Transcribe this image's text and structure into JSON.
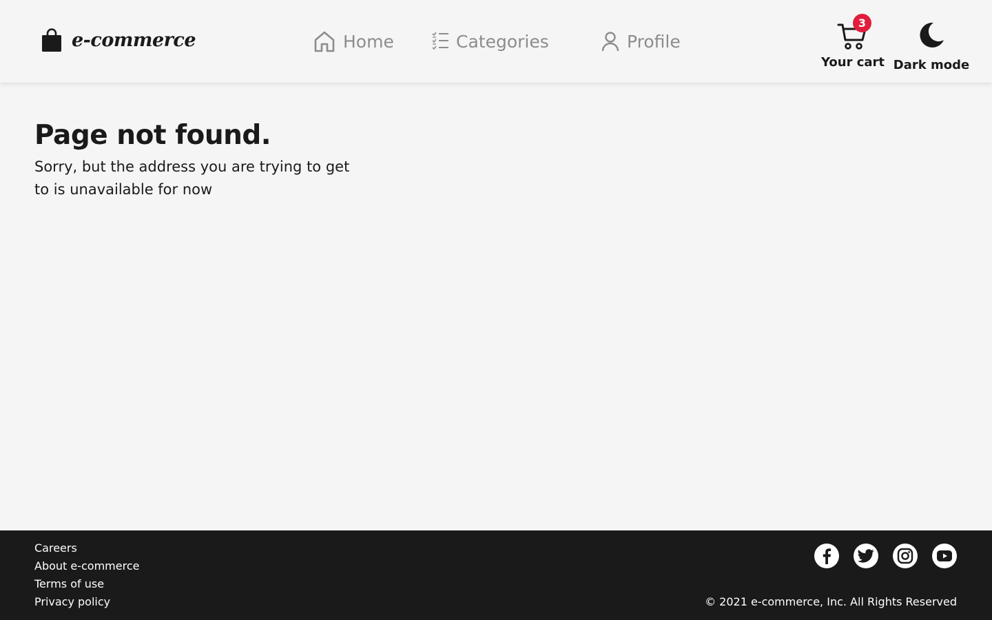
{
  "header": {
    "brand": {
      "name": "e-commerce",
      "icon": "shopping-bag-icon"
    },
    "nav": [
      {
        "label": "Home",
        "icon": "home-icon"
      },
      {
        "label": "Categories",
        "icon": "list-icon"
      },
      {
        "label": "Profile",
        "icon": "user-icon"
      }
    ],
    "cart": {
      "label": "Your cart",
      "count": "3",
      "icon": "cart-icon"
    },
    "dark_mode": {
      "label": "Dark mode",
      "icon": "moon-icon"
    }
  },
  "main": {
    "title": "Page not found.",
    "message": "Sorry, but the address you are trying to get to is unavailable for now"
  },
  "footer": {
    "links": [
      "Careers",
      "About e-commerce",
      "Terms of use",
      "Privacy policy"
    ],
    "socials": [
      "facebook-icon",
      "twitter-icon",
      "instagram-icon",
      "youtube-icon"
    ],
    "copyright": "© 2021 e-commerce, Inc. All Rights Reserved"
  },
  "colors": {
    "background": "#f5f5f5",
    "text": "#1a1a1a",
    "nav_muted": "#8c8c8c",
    "badge": "#e01e3c",
    "footer_bg": "#1a1a1a"
  }
}
